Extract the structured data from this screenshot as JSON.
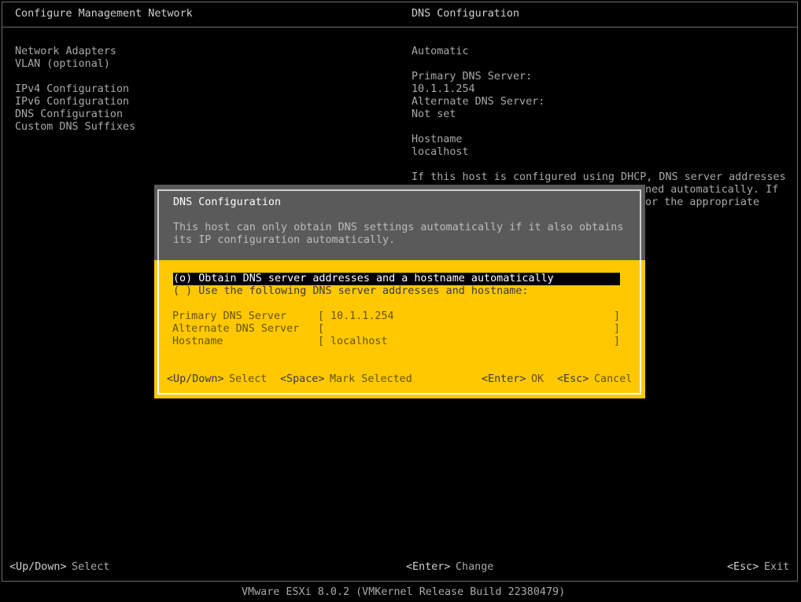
{
  "window": {
    "left_title": "Configure Management Network",
    "right_title": "DNS Configuration"
  },
  "menu": {
    "items": [
      "Network Adapters",
      "VLAN (optional)",
      "IPv4 Configuration",
      "IPv6 Configuration",
      "DNS Configuration",
      "Custom DNS Suffixes"
    ]
  },
  "details": {
    "mode": "Automatic",
    "primary_label": "Primary DNS Server:",
    "primary_value": "10.1.1.254",
    "alternate_label": "Alternate DNS Server:",
    "alternate_value": "Not set",
    "hostname_label": "Hostname",
    "hostname_value": "localhost",
    "help_line1": "If this host is configured using DHCP, DNS server addresses",
    "help_line2": "ned automatically. If",
    "help_line3": "or the appropriate"
  },
  "dialog": {
    "title": "DNS Configuration",
    "desc_line1": "This host can only obtain DNS settings automatically if it also obtains",
    "desc_line2": "its IP configuration automatically.",
    "option_auto": "(o) Obtain DNS server addresses and a hostname automatically",
    "option_manual": "( ) Use the following DNS server addresses and hostname:",
    "fields": {
      "primary_label": "Primary DNS Server",
      "primary_value": "10.1.1.254",
      "alternate_label": "Alternate DNS Server",
      "alternate_value": "",
      "hostname_label": "Hostname",
      "hostname_value": "localhost",
      "open_bracket": "[",
      "close_bracket": "]"
    },
    "footer": {
      "updown_key": "<Up/Down>",
      "updown_action": "Select",
      "space_key": "<Space>",
      "space_action": "Mark Selected",
      "enter_key": "<Enter>",
      "enter_action": "OK",
      "esc_key": "<Esc>",
      "esc_action": "Cancel"
    }
  },
  "bottom_bar": {
    "updown_key": "<Up/Down>",
    "updown_action": "Select",
    "enter_key": "<Enter>",
    "enter_action": "Change",
    "esc_key": "<Esc>",
    "esc_action": "Exit"
  },
  "footer_version": "VMware ESXi 8.0.2 (VMKernel Release Build 22380479)"
}
